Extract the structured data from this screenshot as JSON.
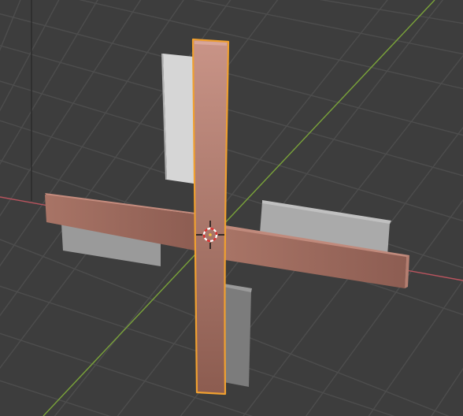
{
  "viewport": {
    "name": "3D Viewport",
    "background_color": "#3d3d3d",
    "grid_color": "#4d4d4d",
    "x_axis_color": "#b8545e",
    "y_axis_color": "#7aa33a",
    "z_axis_color": "#2a2a2a"
  },
  "scene": {
    "selected_object": {
      "shape": "cross",
      "surface_color": "#b4766a",
      "outline_color": "#f0a030",
      "state": "active"
    },
    "shadow_panels": [
      {
        "name": "back-panel-top",
        "color": "#d6d6d6"
      },
      {
        "name": "back-panel-left",
        "color": "#9a9a9a"
      },
      {
        "name": "back-panel-right",
        "color": "#aaaaaa"
      },
      {
        "name": "back-panel-bottom",
        "color": "#7c7c7c"
      }
    ]
  },
  "cursor": {
    "name": "3d-cursor-icon",
    "ring_colors": [
      "#e03030",
      "#ffffff"
    ]
  }
}
